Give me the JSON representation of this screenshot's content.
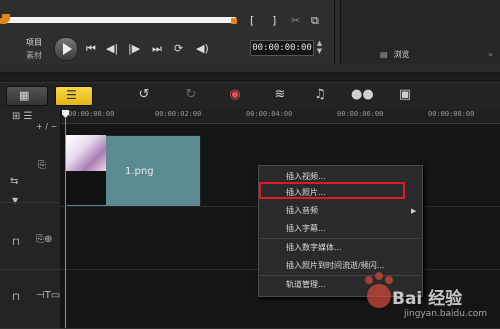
{
  "preview": {
    "project_label": "项目",
    "clip_label": "素材",
    "timecode": "00:00:00:00",
    "bracket_in": "[",
    "bracket_out": "]",
    "browse_label": "浏览"
  },
  "ruler": {
    "ticks": [
      "00:00:00:00",
      "00:00:02:00",
      "00:00:04:00",
      "00:00:06:00",
      "00:00:08:00"
    ]
  },
  "clip": {
    "filename": "1.png"
  },
  "context_menu": {
    "items": [
      "插入视频...",
      "插入照片...",
      "插入音频",
      "插入字幕...",
      "插入数字媒体...",
      "插入照片到时间流逝/频闪...",
      "轨道管理..."
    ],
    "highlighted_index": 1
  },
  "watermark": {
    "main": "Bai 经验",
    "sub": "jingyan.baidu.com"
  },
  "colors": {
    "accent_orange": "#e8821c",
    "timeline_button_yellow": "#e3b412",
    "clip_teal": "#5b8a93",
    "highlight_red": "#e0192a",
    "playhead_blue": "#4fa0d8"
  }
}
